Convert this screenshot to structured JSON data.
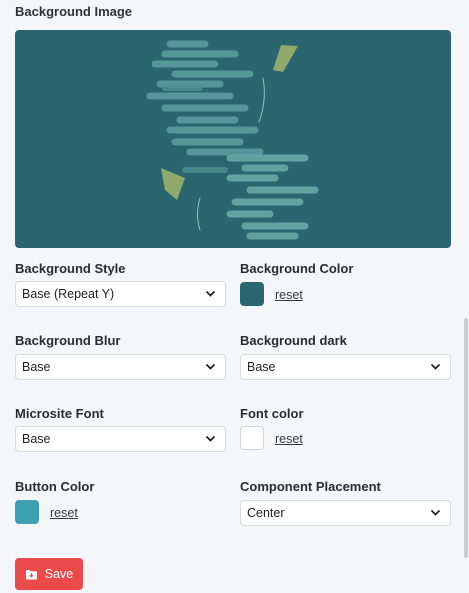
{
  "section_title": "Background Image",
  "colors": {
    "preview_bg": "#2b6570",
    "background_color": "#2d6673",
    "font_color": "#ffffff",
    "button_color": "#3da0b3",
    "save_button": "#ea4a4a"
  },
  "fields": {
    "background_style": {
      "label": "Background Style",
      "value": "Base (Repeat Y)"
    },
    "background_color": {
      "label": "Background Color",
      "reset": "reset"
    },
    "background_blur": {
      "label": "Background Blur",
      "value": "Base"
    },
    "background_dark": {
      "label": "Background dark",
      "value": "Base"
    },
    "microsite_font": {
      "label": "Microsite Font",
      "value": "Base"
    },
    "font_color": {
      "label": "Font color",
      "reset": "reset"
    },
    "button_color": {
      "label": "Button Color",
      "reset": "reset"
    },
    "component_placement": {
      "label": "Component Placement",
      "value": "Center"
    }
  },
  "save_label": "Save",
  "icons": {
    "chevron": "chevron-down-icon",
    "save": "save-icon"
  }
}
